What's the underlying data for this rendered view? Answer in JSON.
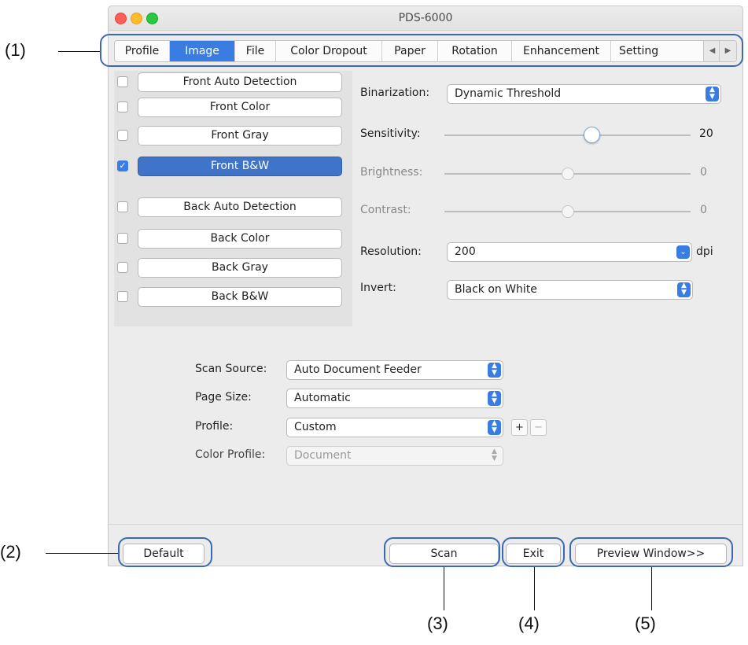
{
  "window": {
    "title": "PDS-6000"
  },
  "tabs": [
    {
      "label": "Profile",
      "active": false
    },
    {
      "label": "Image",
      "active": true
    },
    {
      "label": "File",
      "active": false
    },
    {
      "label": "Color Dropout",
      "active": false
    },
    {
      "label": "Paper",
      "active": false
    },
    {
      "label": "Rotation",
      "active": false
    },
    {
      "label": "Enhancement",
      "active": false
    },
    {
      "label": "Setting",
      "active": false
    }
  ],
  "image_types": [
    {
      "label": "Front Auto Detection",
      "checked": false,
      "active": false
    },
    {
      "label": "Front Color",
      "checked": false,
      "active": false
    },
    {
      "label": "Front Gray",
      "checked": false,
      "active": false
    },
    {
      "label": "Front B&W",
      "checked": true,
      "active": true
    },
    {
      "label": "Back Auto Detection",
      "checked": false,
      "active": false
    },
    {
      "label": "Back Color",
      "checked": false,
      "active": false
    },
    {
      "label": "Back Gray",
      "checked": false,
      "active": false
    },
    {
      "label": "Back B&W",
      "checked": false,
      "active": false
    }
  ],
  "settings": {
    "binarization_label": "Binarization:",
    "binarization_value": "Dynamic Threshold",
    "sensitivity_label": "Sensitivity:",
    "sensitivity_value": "20",
    "sensitivity_fraction": 0.6,
    "brightness_label": "Brightness:",
    "brightness_value": "0",
    "brightness_fraction": 0.5,
    "contrast_label": "Contrast:",
    "contrast_value": "0",
    "contrast_fraction": 0.5,
    "resolution_label": "Resolution:",
    "resolution_value": "200",
    "resolution_unit": "dpi",
    "invert_label": "Invert:",
    "invert_value": "Black on White"
  },
  "source": {
    "scan_source_label": "Scan Source:",
    "scan_source_value": "Auto Document Feeder",
    "page_size_label": "Page Size:",
    "page_size_value": "Automatic",
    "profile_label": "Profile:",
    "profile_value": "Custom",
    "profile_add": "+",
    "profile_remove": "−",
    "color_profile_label": "Color Profile:",
    "color_profile_value": "Document"
  },
  "buttons": {
    "default": "Default",
    "scan": "Scan",
    "exit": "Exit",
    "preview": "Preview Window>>"
  },
  "callouts": [
    "(1)",
    "(2)",
    "(3)",
    "(4)",
    "(5)"
  ],
  "colors": {
    "accent": "#3a7de2",
    "callout_border": "#3a6ab0"
  }
}
